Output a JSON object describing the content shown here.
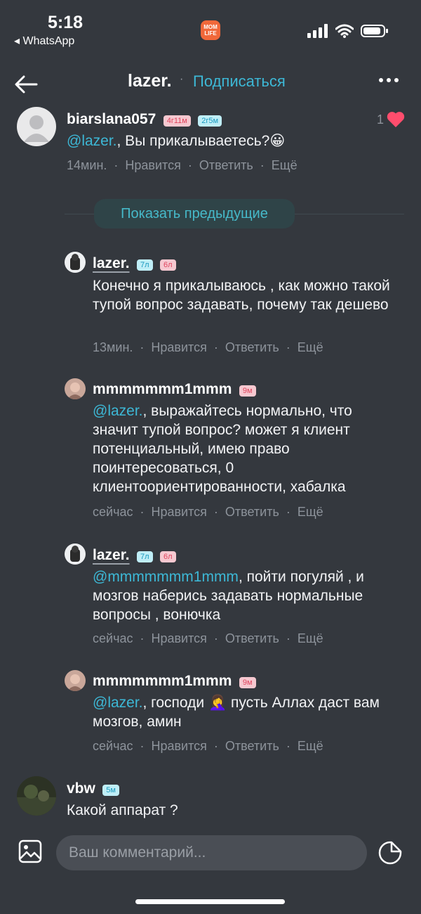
{
  "status_bar": {
    "time": "5:18",
    "back_app": "◂ WhatsApp",
    "app_badge": "MOM LIFE"
  },
  "header": {
    "title": "lazer.",
    "separator": "·",
    "subscribe_label": "Подписаться"
  },
  "comments": [
    {
      "user": "biarslana057",
      "badges": [
        "4г11м",
        "2г5м"
      ],
      "mention": "@lazer.",
      "text": ", Вы прикалываетесь?",
      "emoji": "😀",
      "time": "14мин.",
      "likes": "1"
    },
    {
      "user": "lazer.",
      "badges": [
        "7л",
        "6л"
      ],
      "text": "Конечно я прикалываюсь , как можно такой тупой вопрос задавать, почему так дешево",
      "time": "13мин."
    },
    {
      "user": "mmmmmmm1mmm",
      "badges": [
        "9м"
      ],
      "mention": "@lazer.",
      "text": ", выражайтесь нормально, что значит тупой вопрос? может я клиент потенциальный, имею право поинтересоваться, 0 клиентоориентированности, хабалка",
      "time": "сейчас"
    },
    {
      "user": "lazer.",
      "badges": [
        "7л",
        "6л"
      ],
      "mention": "@mmmmmmm1mmm",
      "text": ", пойти погуляй , и мозгов наберись задавать нормальные вопросы , вонючка",
      "time": "сейчас"
    },
    {
      "user": "mmmmmmm1mmm",
      "badges": [
        "9м"
      ],
      "mention": "@lazer.",
      "text_a": ", господи ",
      "emoji": "🤦‍♀️",
      "text_b": " пусть Аллах даст вам мозгов, амин",
      "time": "сейчас"
    },
    {
      "user": "vbw",
      "badges": [
        "5м"
      ],
      "text": "Какой аппарат ?"
    }
  ],
  "actions": {
    "like": "Нравится",
    "reply": "Ответить",
    "more": "Ещё",
    "dot": "·"
  },
  "show_previous_label": "Показать предыдущие",
  "composer": {
    "placeholder": "Ваш комментарий..."
  },
  "colors": {
    "background": "#34383e",
    "accent": "#3db8d6",
    "heart": "#ff4d6d"
  }
}
